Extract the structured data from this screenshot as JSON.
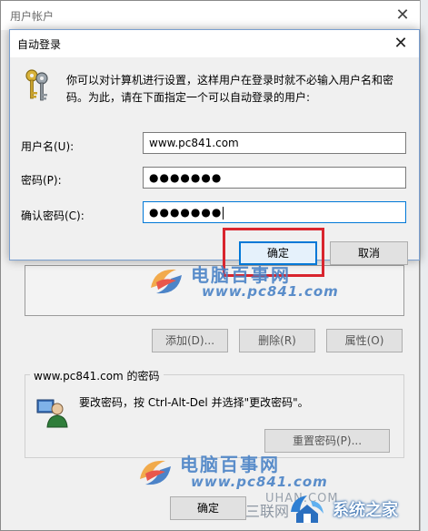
{
  "background_window": {
    "title": "用户帐户",
    "close_glyph": "✕",
    "buttons": {
      "add": "添加(D)...",
      "delete": "删除(R)",
      "properties": "属性(O)"
    },
    "password_group": {
      "title": "www.pc841.com 的密码",
      "text": "要改密码，按 Ctrl-Alt-Del 并选择\"更改密码\"。",
      "reset_button": "重置密码(P)..."
    },
    "ok_button": "确定"
  },
  "dialog": {
    "title": "自动登录",
    "close_glyph": "✕",
    "description": "你可以对计算机进行设置，这样用户在登录时就不必输入用户名和密码。为此，请在下面指定一个可以自动登录的用户:",
    "fields": {
      "username_label": "用户名(U):",
      "username_value": "www.pc841.com",
      "password_label": "密码(P):",
      "password_value": "●●●●●●●",
      "confirm_label": "确认密码(C):",
      "confirm_value": "●●●●●●●"
    },
    "ok_button": "确定",
    "cancel_button": "取消"
  },
  "watermarks": {
    "site_name": "电脑百事网",
    "site_url": "www.pc841.com",
    "tail_text": "UHAN.COM",
    "overlay_text": "三联网",
    "brand": "系统之家"
  },
  "colors": {
    "accent": "#0078d7",
    "highlight": "#d9252e",
    "watermark": "#4a83c6"
  },
  "icons": {
    "dialog": "keys-icon",
    "password_group": "user-icon",
    "watermark": "swirl-logo-icon",
    "brand": "house-logo-icon"
  }
}
